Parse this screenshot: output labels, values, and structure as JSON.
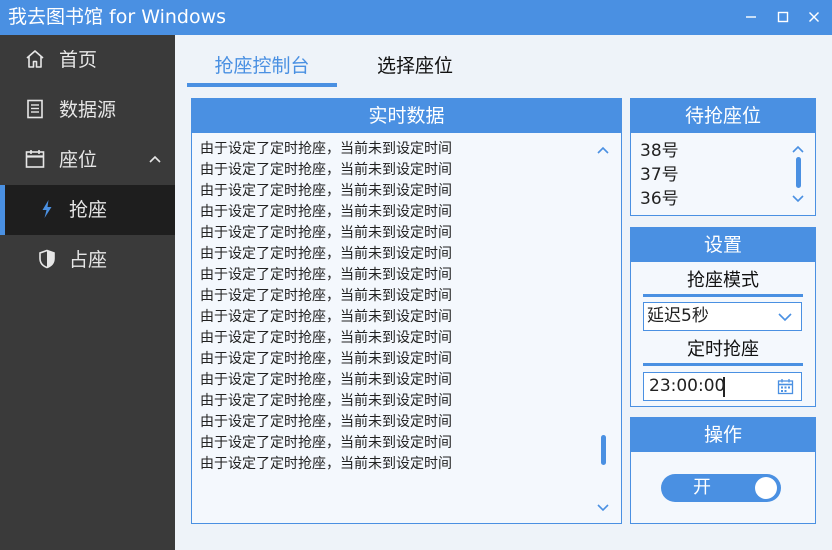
{
  "window": {
    "title": "我去图书馆  for Windows"
  },
  "sidebar": {
    "items": [
      {
        "label": "首页",
        "icon": "home-icon"
      },
      {
        "label": "数据源",
        "icon": "document-icon"
      },
      {
        "label": "座位",
        "icon": "calendar-icon",
        "expanded": true
      },
      {
        "label": "抢座",
        "icon": "lightning-icon",
        "active": true
      },
      {
        "label": "占座",
        "icon": "shield-icon"
      }
    ]
  },
  "tabs": [
    {
      "label": "抢座控制台",
      "active": true
    },
    {
      "label": "选择座位",
      "active": false
    }
  ],
  "realtime": {
    "title": "实时数据",
    "lines": [
      "由于设定了定时抢座，当前未到设定时间",
      "由于设定了定时抢座，当前未到设定时间",
      "由于设定了定时抢座，当前未到设定时间",
      "由于设定了定时抢座，当前未到设定时间",
      "由于设定了定时抢座，当前未到设定时间",
      "由于设定了定时抢座，当前未到设定时间",
      "由于设定了定时抢座，当前未到设定时间",
      "由于设定了定时抢座，当前未到设定时间",
      "由于设定了定时抢座，当前未到设定时间",
      "由于设定了定时抢座，当前未到设定时间",
      "由于设定了定时抢座，当前未到设定时间",
      "由于设定了定时抢座，当前未到设定时间",
      "由于设定了定时抢座，当前未到设定时间",
      "由于设定了定时抢座，当前未到设定时间",
      "由于设定了定时抢座，当前未到设定时间",
      "由于设定了定时抢座，当前未到设定时间"
    ]
  },
  "seats": {
    "title": "待抢座位",
    "items": [
      "38号",
      "37号",
      "36号"
    ]
  },
  "settings": {
    "title": "设置",
    "mode_label": "抢座模式",
    "mode_value": "延迟5秒",
    "timer_label": "定时抢座",
    "timer_value": "23:00:00"
  },
  "operations": {
    "title": "操作",
    "toggle_label": "开",
    "toggle_on": true
  },
  "colors": {
    "accent": "#4a90e2",
    "sidebar_bg": "#3a3a3a",
    "sidebar_active_bg": "#1e1e1e",
    "content_bg": "#eef3f9"
  }
}
